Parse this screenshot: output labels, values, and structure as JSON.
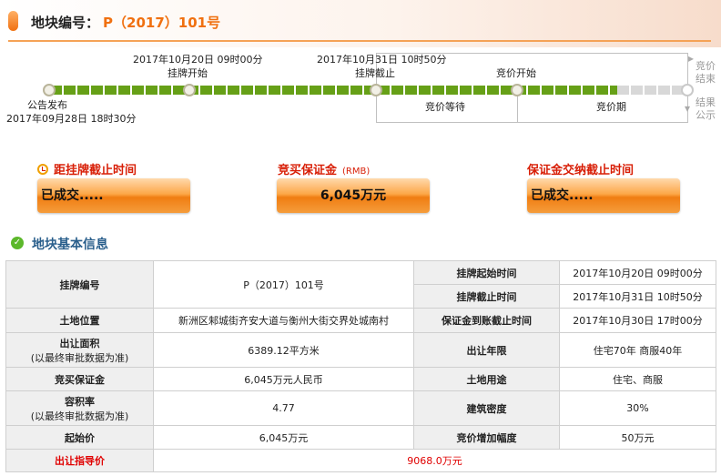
{
  "header": {
    "title_prefix": "地块编号：",
    "parcel_code": "P（2017）101号"
  },
  "timeline": {
    "start_label": "公告发布",
    "start_time": "2017年09月28日  18时30分",
    "listing_start_time": "2017年10月20日  09时00分",
    "listing_start_label": "挂牌开始",
    "listing_end_time": "2017年10月31日  10时50分",
    "listing_end_label": "挂牌截止",
    "bidding_start_label": "竞价开始",
    "waiting_label": "竞价等待",
    "bidding_period_label": "竞价期",
    "bidding_end_label": "竞价\n结束",
    "result_label": "结果\n公示"
  },
  "counters": [
    {
      "title": "距挂牌截止时间",
      "value": "已成交....."
    },
    {
      "title": "竞买保证金",
      "unit": "(RMB)",
      "value": "6,045万元"
    },
    {
      "title": "保证金交纳截止时间",
      "value": "已成交....."
    }
  ],
  "section": {
    "title": "地块基本信息"
  },
  "table": {
    "listing_code_label": "挂牌编号",
    "listing_code": "P（2017）101号",
    "listing_start_label": "挂牌起始时间",
    "listing_start": "2017年10月20日  09时00分",
    "listing_end_label": "挂牌截止时间",
    "listing_end": "2017年10月31日  10时50分",
    "location_label": "土地位置",
    "location": "新洲区邾城街齐安大道与衡州大街交界处城南村",
    "deposit_deadline_label": "保证金到账截止时间",
    "deposit_deadline": "2017年10月30日  17时00分",
    "area_label": "出让面积",
    "area_note": "(以最终审批数据为准)",
    "area": "6389.12平方米",
    "term_label": "出让年限",
    "term": "住宅70年  商服40年",
    "deposit_label": "竞买保证金",
    "deposit": "6,045万元人民币",
    "usage_label": "土地用途",
    "usage": "住宅、商服",
    "far_label": "容积率",
    "far_note": "(以最终审批数据为准)",
    "far": "4.77",
    "density_label": "建筑密度",
    "density": "30%",
    "start_price_label": "起始价",
    "start_price": "6,045万元",
    "increment_label": "竞价增加幅度",
    "increment": "50万元",
    "guide_price_label": "出让指导价",
    "guide_price": "9068.0万元"
  },
  "colors": {
    "accent": "#f07010",
    "timeline_done": "#66a017",
    "alert_red": "#e00000",
    "section_blue": "#2a5f8c"
  }
}
